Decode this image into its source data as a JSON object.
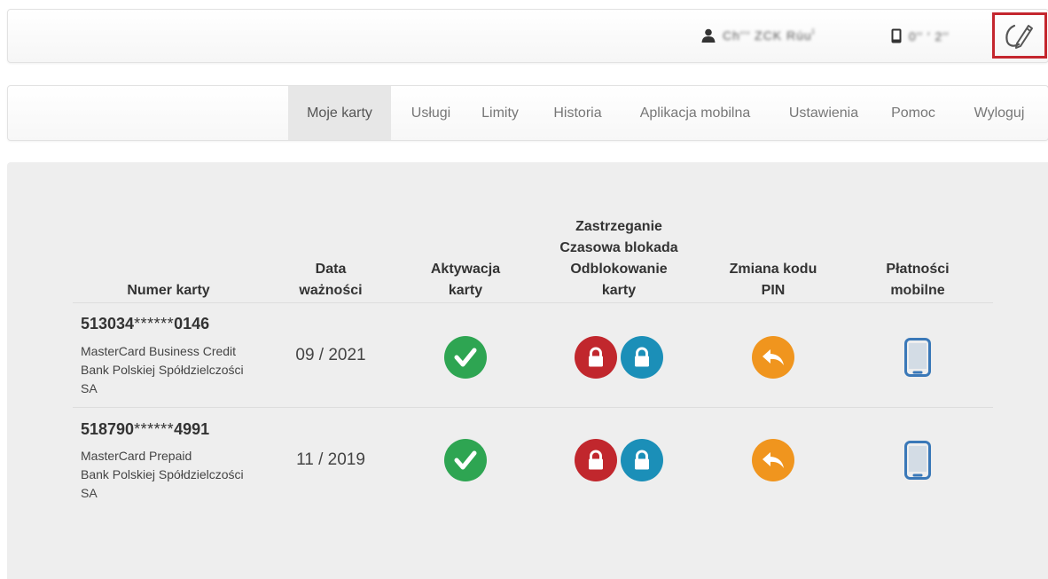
{
  "header": {
    "user_name": "Ch′’′ ZCK Rúu′́",
    "phone": "0′′ ′ 2′′",
    "icons": {
      "user": "user-icon",
      "phone": "mobile-phone-icon",
      "logout": "pen-logout-icon"
    },
    "highlight_color": "#c4262e"
  },
  "nav": {
    "items": [
      "Moje karty",
      "Usługi",
      "Limity",
      "Historia",
      "Aplikacja mobilna",
      "Ustawienia",
      "Pomoc",
      "Wyloguj"
    ],
    "active": "Moje karty"
  },
  "table": {
    "headers": {
      "card_number": "Numer karty",
      "expiry_line1": "Data",
      "expiry_line2": "ważności",
      "activation_line1": "Aktywacja",
      "activation_line2": "karty",
      "block_line1": "Zastrzeganie",
      "block_line2": "Czasowa blokada",
      "block_line3": "Odblokowanie",
      "block_line4": "karty",
      "pin_line1": "Zmiana kodu",
      "pin_line2": "PIN",
      "mobile_line1": "Płatności",
      "mobile_line2": "mobilne"
    },
    "rows": [
      {
        "number_prefix": "513034",
        "number_mask": "******",
        "number_suffix": "0146",
        "type": "MasterCard Business Credit",
        "bank_line1": "Bank Polskiej Spółdzielczości",
        "bank_line2": "SA",
        "expiry": "09 / 2021"
      },
      {
        "number_prefix": "518790",
        "number_mask": "******",
        "number_suffix": "4991",
        "type": "MasterCard Prepaid",
        "bank_line1": "Bank Polskiej Spółdzielczości",
        "bank_line2": "SA",
        "expiry": "11 / 2019"
      }
    ]
  },
  "colors": {
    "activate": "#2ea552",
    "block": "#c1272d",
    "temp_block": "#1b8fb8",
    "pin": "#f0951e",
    "mobile": "#3a78b8",
    "background": "#eeeeee"
  }
}
